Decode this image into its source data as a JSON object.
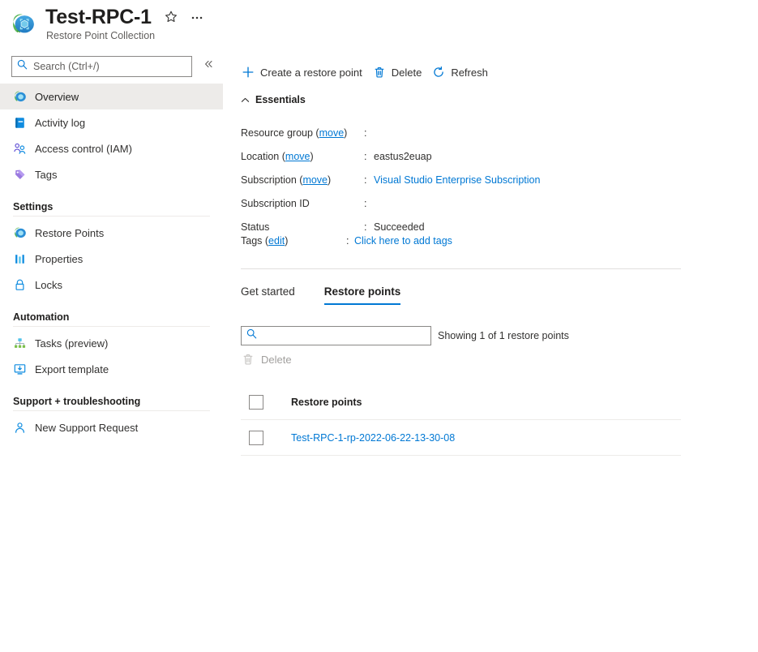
{
  "header": {
    "title": "Test-RPC-1",
    "subtitle": "Restore Point Collection",
    "resource_icon": "restore-point-collection-icon",
    "favorite_icon": "star-icon",
    "more_icon": "ellipsis-icon"
  },
  "sidebar": {
    "search": {
      "placeholder": "Search (Ctrl+/)",
      "value": "",
      "icon": "search-icon"
    },
    "collapse_icon": "chevron-double-left-icon",
    "items": [
      {
        "label": "Overview",
        "icon": "overview-icon",
        "selected": true
      },
      {
        "label": "Activity log",
        "icon": "activity-log-icon",
        "selected": false
      },
      {
        "label": "Access control (IAM)",
        "icon": "access-control-icon",
        "selected": false
      },
      {
        "label": "Tags",
        "icon": "tags-icon",
        "selected": false
      }
    ],
    "groups": [
      {
        "title": "Settings",
        "items": [
          {
            "label": "Restore Points",
            "icon": "restore-points-icon"
          },
          {
            "label": "Properties",
            "icon": "properties-icon"
          },
          {
            "label": "Locks",
            "icon": "lock-icon"
          }
        ]
      },
      {
        "title": "Automation",
        "items": [
          {
            "label": "Tasks (preview)",
            "icon": "tasks-icon"
          },
          {
            "label": "Export template",
            "icon": "export-template-icon"
          }
        ]
      },
      {
        "title": "Support + troubleshooting",
        "items": [
          {
            "label": "New Support Request",
            "icon": "support-request-icon"
          }
        ]
      }
    ]
  },
  "command_bar": {
    "create": {
      "label": "Create a restore point",
      "icon": "plus-icon"
    },
    "delete": {
      "label": "Delete",
      "icon": "trash-icon"
    },
    "refresh": {
      "label": "Refresh",
      "icon": "refresh-icon"
    }
  },
  "essentials": {
    "title": "Essentials",
    "collapse_icon": "chevron-up-icon",
    "rows": [
      {
        "key": "Resource group",
        "key_link": "move",
        "value": "",
        "is_link": false,
        "redacted": true
      },
      {
        "key": "Location",
        "key_link": "move",
        "value": "eastus2euap",
        "is_link": false,
        "redacted": false
      },
      {
        "key": "Subscription",
        "key_link": "move",
        "value": "Visual Studio Enterprise Subscription",
        "is_link": true,
        "redacted": false
      },
      {
        "key": "Subscription ID",
        "key_link": "",
        "value": "",
        "is_link": false,
        "redacted": true
      },
      {
        "key": "Status",
        "key_link": "",
        "value": "Succeeded",
        "is_link": false,
        "redacted": false
      }
    ],
    "tags": {
      "key": "Tags",
      "key_link": "edit",
      "value": "Click here to add tags"
    }
  },
  "tabs": [
    {
      "label": "Get started",
      "active": false
    },
    {
      "label": "Restore points",
      "active": true
    }
  ],
  "restore_points_panel": {
    "search": {
      "placeholder": "",
      "value": "",
      "icon": "search-icon"
    },
    "showing_text": "Showing 1 of 1 restore points",
    "delete_button": {
      "label": "Delete",
      "icon": "trash-icon",
      "disabled": true
    },
    "table": {
      "select_all_checkbox": false,
      "columns": [
        "Restore points"
      ],
      "rows": [
        {
          "checked": false,
          "name": "Test-RPC-1-rp-2022-06-22-13-30-08"
        }
      ]
    }
  },
  "colors": {
    "accent": "#0078d4",
    "link": "#0078d4",
    "text": "#323130",
    "text_strong": "#201f1e",
    "text_muted": "#605e5c",
    "disabled": "#a19f9d",
    "selected_bg": "#edebe9",
    "divider": "#e1dfdd"
  }
}
